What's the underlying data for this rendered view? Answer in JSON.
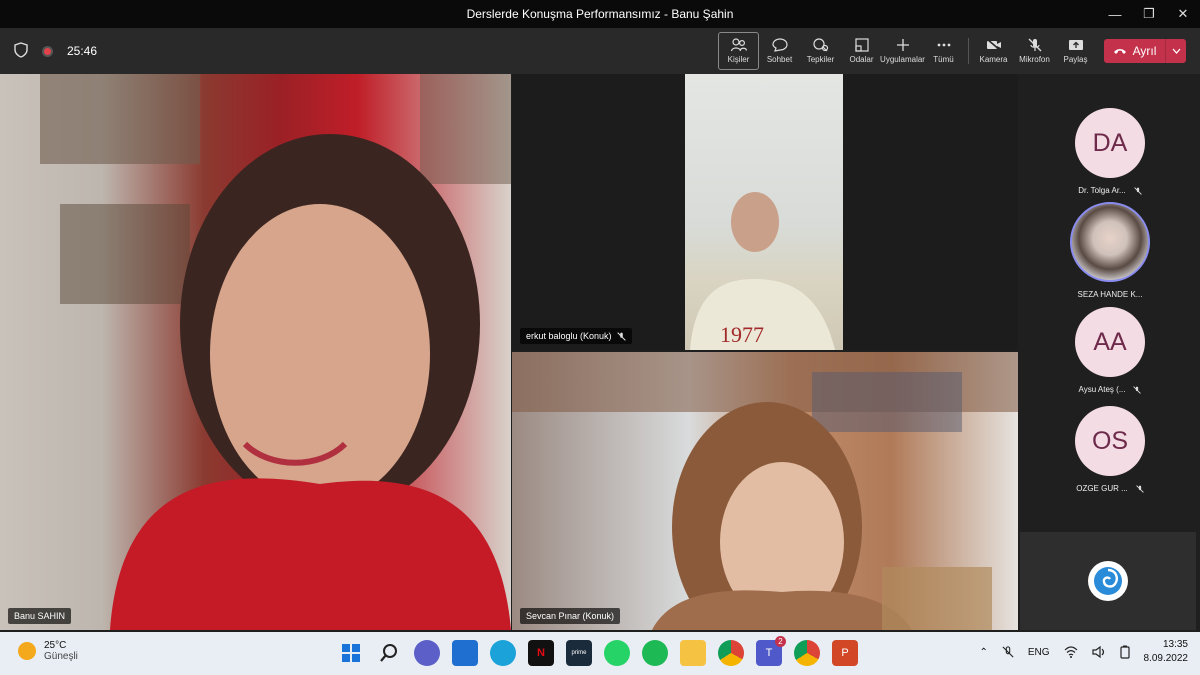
{
  "window": {
    "title": "Derslerde Konuşma Performansımız - Banu Şahin"
  },
  "meeting": {
    "timer": "25:46"
  },
  "toolbar": {
    "buttons": [
      {
        "label": "Kişiler",
        "icon": "people-icon"
      },
      {
        "label": "Sohbet",
        "icon": "chat-icon"
      },
      {
        "label": "Tepkiler",
        "icon": "reactions-icon"
      },
      {
        "label": "Odalar",
        "icon": "rooms-icon"
      },
      {
        "label": "Uygulamalar",
        "icon": "plus-icon"
      },
      {
        "label": "Tümü",
        "icon": "more-icon"
      },
      {
        "label": "Kamera",
        "icon": "camera-off-icon"
      },
      {
        "label": "Mikrofon",
        "icon": "mic-off-icon"
      },
      {
        "label": "Paylaş",
        "icon": "share-icon"
      }
    ],
    "leave_label": "Ayrıl"
  },
  "tiles": {
    "main": "Banu SAHIN",
    "top_right": "erkut baloglu (Konuk)",
    "bottom_right": "Sevcan Pınar (Konuk)"
  },
  "roster": [
    {
      "initials": "DA",
      "name": "Dr. Tolga Ar..."
    },
    {
      "initials": "",
      "name": "SEZA HANDE K..."
    },
    {
      "initials": "AA",
      "name": "Aysu Ateş (..."
    },
    {
      "initials": "OS",
      "name": "OZGE GUR ..."
    }
  ],
  "taskbar": {
    "weather_temp": "25°C",
    "weather_desc": "Güneşli",
    "language": "ENG",
    "time": "13:35",
    "date": "8.09.2022",
    "teams_badge": "2"
  },
  "colors": {
    "leave": "#c4314b",
    "avatar_bg": "#f4dce4",
    "avatar_text": "#6d2a4a",
    "accent": "#8a8cf0"
  }
}
